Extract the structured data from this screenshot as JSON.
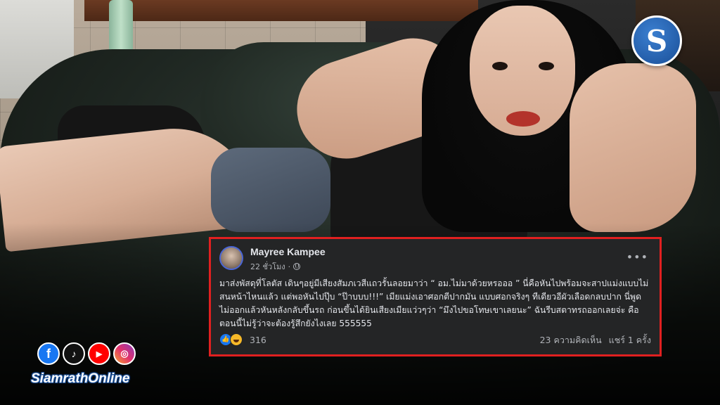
{
  "watermark": {
    "logo_letter": "S",
    "logo_color": "#1f5aa6"
  },
  "post": {
    "author": "Mayree Kampee",
    "time": "22 ชั่วโมง",
    "privacy_icon": "globe-icon",
    "menu_icon": "more-icon",
    "text": "มาส่งพัสดุที่โลตัส เดินๆอยู่มีเสียงสัมภเวสีแถวรั้นลอยมาว่า “ อม.ไม่มาด้วยหรอออ ” นี่คือหันไปพร้อมจะสาปแม่งแบบไม่สนหน้าไหนแล้ว แต่พอหันไปปุ๊บ “ป๊าบบบ!!!” เมียแม่งเอาศอกตีปากมัน แบบศอกจริงๆ ทีเดียวอีผัวเลือดกลบปาก นี่พูดไม่ออกแล้วหันหลังกลับขึ้นรถ ก่อนขึ้นได้ยินเสียงเมียแว่วๆว่า “มึงไปขอโทษเขาเลยนะ” ฉันรีบสตาทรถออกเลยจ่ะ คือตอนนี้ไม่รู้ว่าจะต้องรู้สึกยังไงเลย 555555",
    "reaction_count": "316",
    "comments": "23 ความคิดเห็น",
    "shares": "แชร์ 1 ครั้ง",
    "border_color": "#e02020",
    "card_color": "#242526"
  },
  "social": {
    "icons": [
      "facebook-icon",
      "tiktok-icon",
      "youtube-icon",
      "instagram-icon"
    ],
    "fb_glyph": "f",
    "tt_glyph": "♪",
    "yt_glyph": "▶",
    "ig_glyph": "◎",
    "site_name": "SiamrathOnline"
  }
}
